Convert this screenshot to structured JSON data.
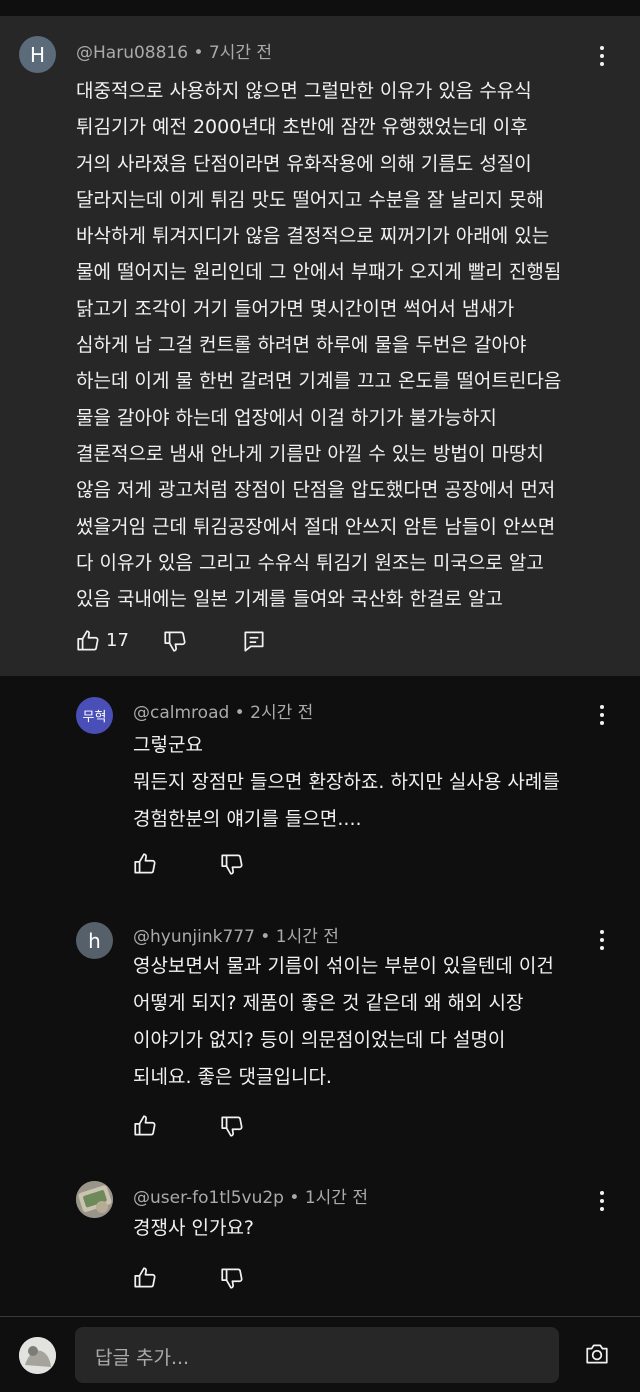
{
  "main_comment": {
    "avatar_letter": "H",
    "author": "@Haru08816",
    "time": "7시간 전",
    "lines": [
      "대중적으로 사용하지 않으면 그럴만한 이유가 있음 수유식",
      "튀김기가 예전 2000년대 초반에 잠깐 유행했었는데 이후",
      "거의 사라졌음 단점이라면 유화작용에 의해 기름도 성질이",
      "달라지는데 이게 튀김 맛도 떨어지고 수분을 잘 날리지 못해",
      "바삭하게 튀겨지디가 않음 결정적으로 찌꺼기가 아래에 있는",
      "물에 떨어지는 원리인데 그 안에서 부패가 오지게 빨리 진행됨",
      "닭고기 조각이 거기 들어가면 몇시간이면 썩어서 냄새가",
      "심하게 남 그걸 컨트롤 하려면 하루에 물을 두번은 갈아야",
      "하는데 이게 물 한번 갈려면 기계를 끄고 온도를 떨어트린다음",
      "물을 갈아야 하는데 업장에서 이걸 하기가 불가능하지",
      "결론적으로 냄새 안나게 기름만 아낄 수 있는 방법이 마땅치",
      "않음 저게 광고처럼 장점이 단점을 압도했다면 공장에서 먼저",
      "썼을거임 근데 튀김공장에서 절대 안쓰지 암튼 남들이 안쓰면",
      "다 이유가 있음 그리고 수유식 튀김기 원조는 미국으로 알고",
      "있음 국내에는 일본 기계를 들여와 국산화 한걸로 알고"
    ],
    "like_count": "17"
  },
  "replies": [
    {
      "avatar_text": "무혁",
      "author": "@calmroad",
      "time": "2시간 전",
      "lines": [
        "그렇군요",
        "뭐든지 장점만 들으면 환장하죠. 하지만 실사용 사례를",
        "경험한분의 얘기를 들으면...."
      ]
    },
    {
      "avatar_text": "h",
      "author": "@hyunjink777",
      "time": "1시간 전",
      "lines": [
        "영상보면서 물과 기름이 섞이는 부분이 있을텐데 이건",
        "어떻게 되지? 제품이 좋은 것 같은데 왜 해외 시장",
        "이야기가 없지? 등이 의문점이었는데 다 설명이",
        "되네요. 좋은 댓글입니다."
      ]
    },
    {
      "avatar_text": "",
      "author": "@user-fo1tl5vu2p",
      "time": "1시간 전",
      "lines": [
        "경쟁사 인가요?"
      ]
    }
  ],
  "reply_box": {
    "placeholder": "답글 추가..."
  },
  "icons": {
    "like": "thumb-up-icon",
    "dislike": "thumb-down-icon",
    "reply": "comment-icon",
    "more": "more-vert-icon",
    "camera": "camera-icon"
  },
  "colors": {
    "background": "#0f0f0f",
    "highlight_background": "#272727",
    "text": "#f1f1f1",
    "meta_text": "#aaaaaa",
    "avatar_main": "#5b6b7a",
    "avatar_calmroad": "#4a4fb8",
    "avatar_hyunjink": "#55606a"
  }
}
